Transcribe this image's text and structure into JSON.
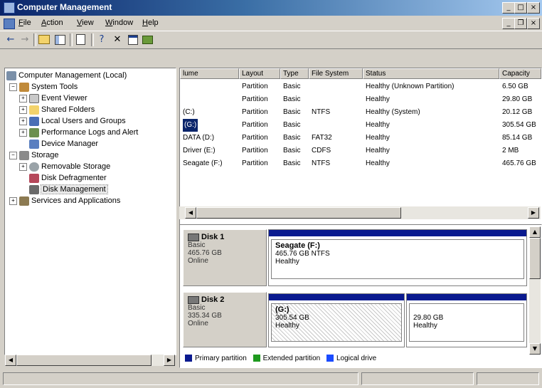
{
  "window": {
    "title": "Computer Management"
  },
  "menu": [
    {
      "label": "File",
      "u": "F",
      "rest": "ile"
    },
    {
      "label": "Action",
      "u": "A",
      "rest": "ction"
    },
    {
      "label": "View",
      "u": "V",
      "rest": "iew"
    },
    {
      "label": "Window",
      "u": "W",
      "rest": "indow"
    },
    {
      "label": "Help",
      "u": "H",
      "rest": "elp"
    }
  ],
  "toolbar": {
    "icons": [
      "back-arrow-icon",
      "forward-arrow-icon",
      "up-folder-icon",
      "show-hide-tree-icon",
      "properties-icon",
      "help-icon",
      "delete-icon",
      "properties-sheet-icon",
      "disk-icon"
    ]
  },
  "tree": {
    "root": "Computer Management (Local)",
    "system_tools": "System Tools",
    "event_viewer": "Event Viewer",
    "shared_folders": "Shared Folders",
    "local_users": "Local Users and Groups",
    "perf_logs": "Performance Logs and Alert",
    "device_manager": "Device Manager",
    "storage": "Storage",
    "removable_storage": "Removable Storage",
    "defrag": "Disk Defragmenter",
    "disk_management": "Disk Management",
    "services": "Services and Applications"
  },
  "volume_list": {
    "headers": [
      "lume",
      "Layout",
      "Type",
      "File System",
      "Status",
      "Capacity"
    ],
    "rows": [
      {
        "volume": "",
        "layout": "Partition",
        "type": "Basic",
        "fs": "",
        "status": "Healthy (Unknown Partition)",
        "capacity": "6.50 GB"
      },
      {
        "volume": "",
        "layout": "Partition",
        "type": "Basic",
        "fs": "",
        "status": "Healthy",
        "capacity": "29.80 GB"
      },
      {
        "volume": "(C:)",
        "layout": "Partition",
        "type": "Basic",
        "fs": "NTFS",
        "status": "Healthy (System)",
        "capacity": "20.12 GB"
      },
      {
        "volume": "(G:)",
        "layout": "Partition",
        "type": "Basic",
        "fs": "",
        "status": "Healthy",
        "capacity": "305.54 GB"
      },
      {
        "volume": "DATA (D:)",
        "layout": "Partition",
        "type": "Basic",
        "fs": "FAT32",
        "status": "Healthy",
        "capacity": "85.14 GB"
      },
      {
        "volume": "Driver (E:)",
        "layout": "Partition",
        "type": "Basic",
        "fs": "CDFS",
        "status": "Healthy",
        "capacity": "2 MB"
      },
      {
        "volume": "Seagate (F:)",
        "layout": "Partition",
        "type": "Basic",
        "fs": "NTFS",
        "status": "Healthy",
        "capacity": "465.76 GB"
      }
    ]
  },
  "disks": {
    "disk1": {
      "name": "Disk 1",
      "type": "Basic",
      "size": "465.76 GB",
      "state": "Online",
      "vol": {
        "name": "Seagate  (F:)",
        "size": "465.76 GB NTFS",
        "status": "Healthy"
      }
    },
    "disk2": {
      "name": "Disk 2",
      "type": "Basic",
      "size": "335.34 GB",
      "state": "Online",
      "vol_a": {
        "name": "(G:)",
        "size": "305.54 GB",
        "status": "Healthy"
      },
      "vol_b": {
        "size": "29.80 GB",
        "status": "Healthy"
      }
    }
  },
  "legend": {
    "primary": "Primary partition",
    "extended": "Extended partition",
    "logical": "Logical drive",
    "colors": {
      "primary": "#0a1a8f",
      "extended": "#1f9a1f",
      "logical": "#1a4bff"
    }
  }
}
